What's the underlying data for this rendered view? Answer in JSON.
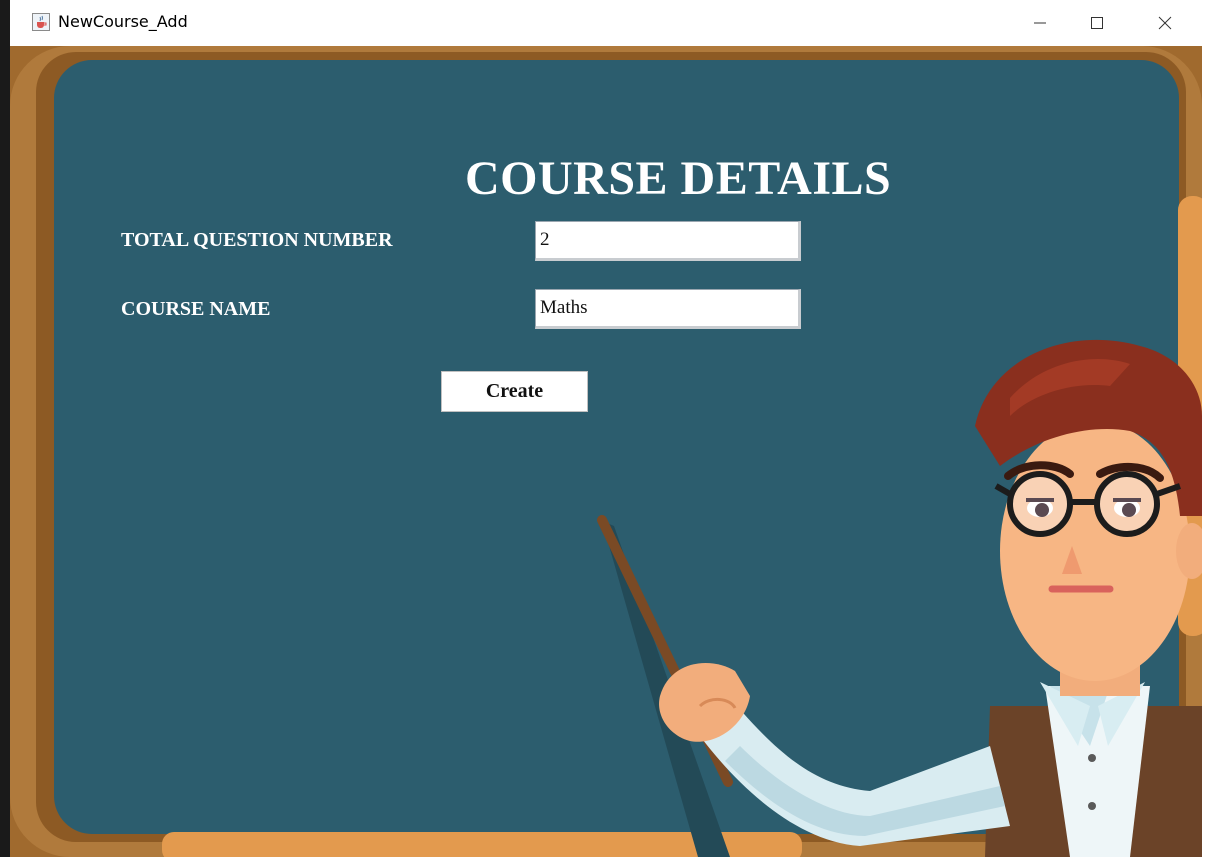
{
  "window": {
    "title": "NewCourse_Add",
    "icon": "java-cup-icon",
    "controls": [
      "minimize-icon",
      "maximize-icon",
      "close-icon"
    ]
  },
  "page": {
    "heading": "COURSE DETAILS"
  },
  "form": {
    "question_label": "TOTAL QUESTION NUMBER",
    "question_value": "2",
    "course_label": "COURSE NAME",
    "course_value": "Maths",
    "create_label": "Create"
  },
  "colors": {
    "chalkboard": "#2c5d6e",
    "frame": "#b07a3c",
    "text": "#ffffff"
  }
}
